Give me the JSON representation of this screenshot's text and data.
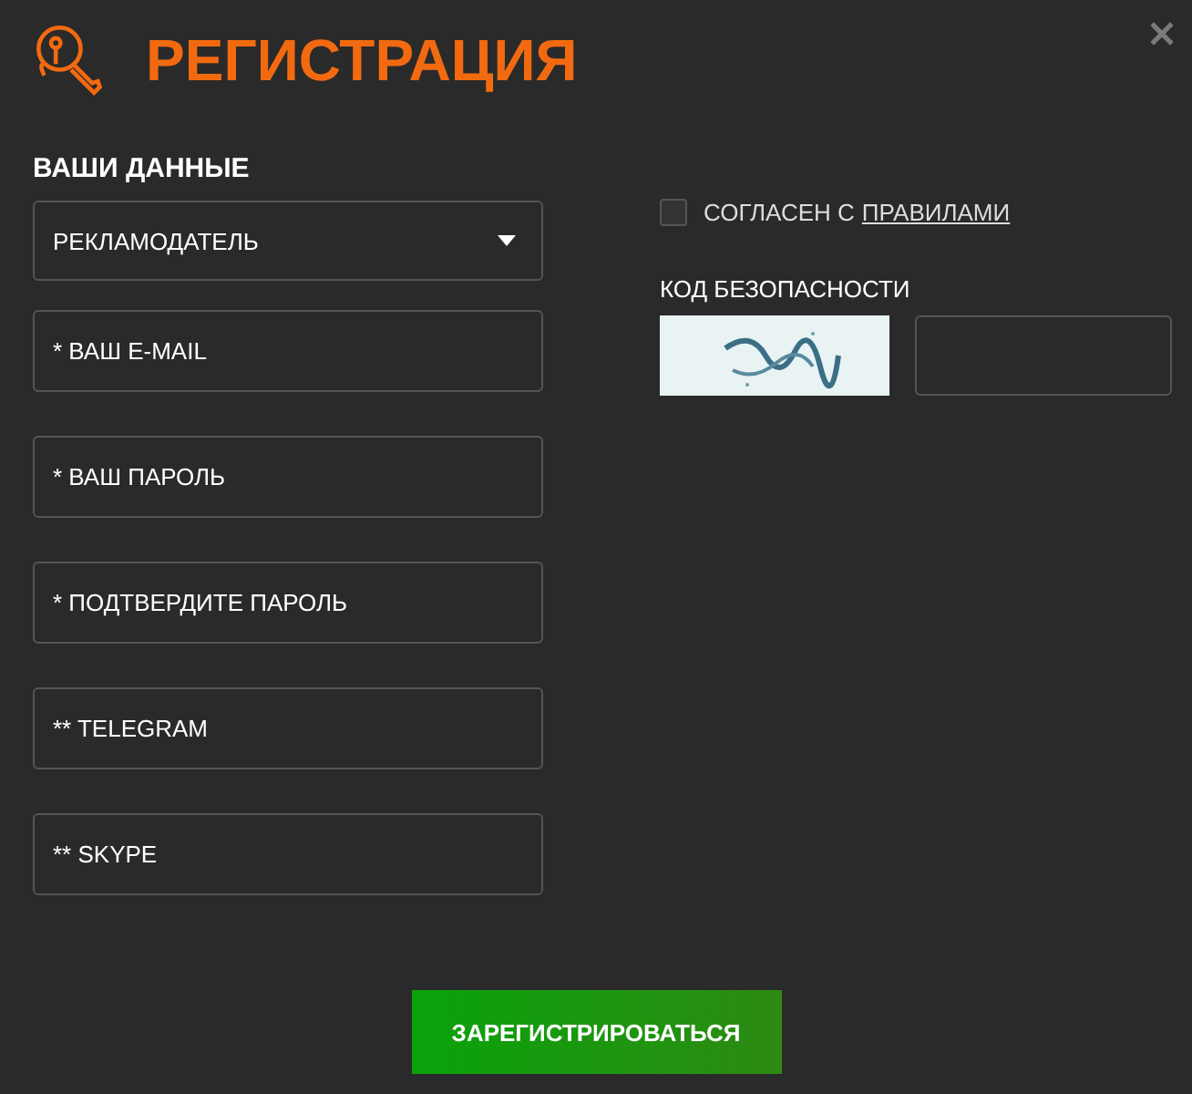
{
  "title": "РЕГИСТРАЦИЯ",
  "section_title": "ВАШИ ДАННЫЕ",
  "account_type": {
    "value": "РЕКЛАМОДАТЕЛЬ"
  },
  "fields": [
    {
      "placeholder": "* ВАШ E-MAIL"
    },
    {
      "placeholder": "* ВАШ ПАРОЛЬ"
    },
    {
      "placeholder": "* ПОДТВЕРДИТЕ ПАРОЛЬ"
    },
    {
      "placeholder": "** TELEGRAM"
    },
    {
      "placeholder": "** SKYPE"
    }
  ],
  "agree": {
    "label": "СОГЛАСЕН С",
    "link": "ПРАВИЛАМИ",
    "checked": false
  },
  "captcha": {
    "label": "КОД БЕЗОПАСНОСТИ"
  },
  "submit": "ЗАРЕГИСТРИРОВАТЬСЯ"
}
